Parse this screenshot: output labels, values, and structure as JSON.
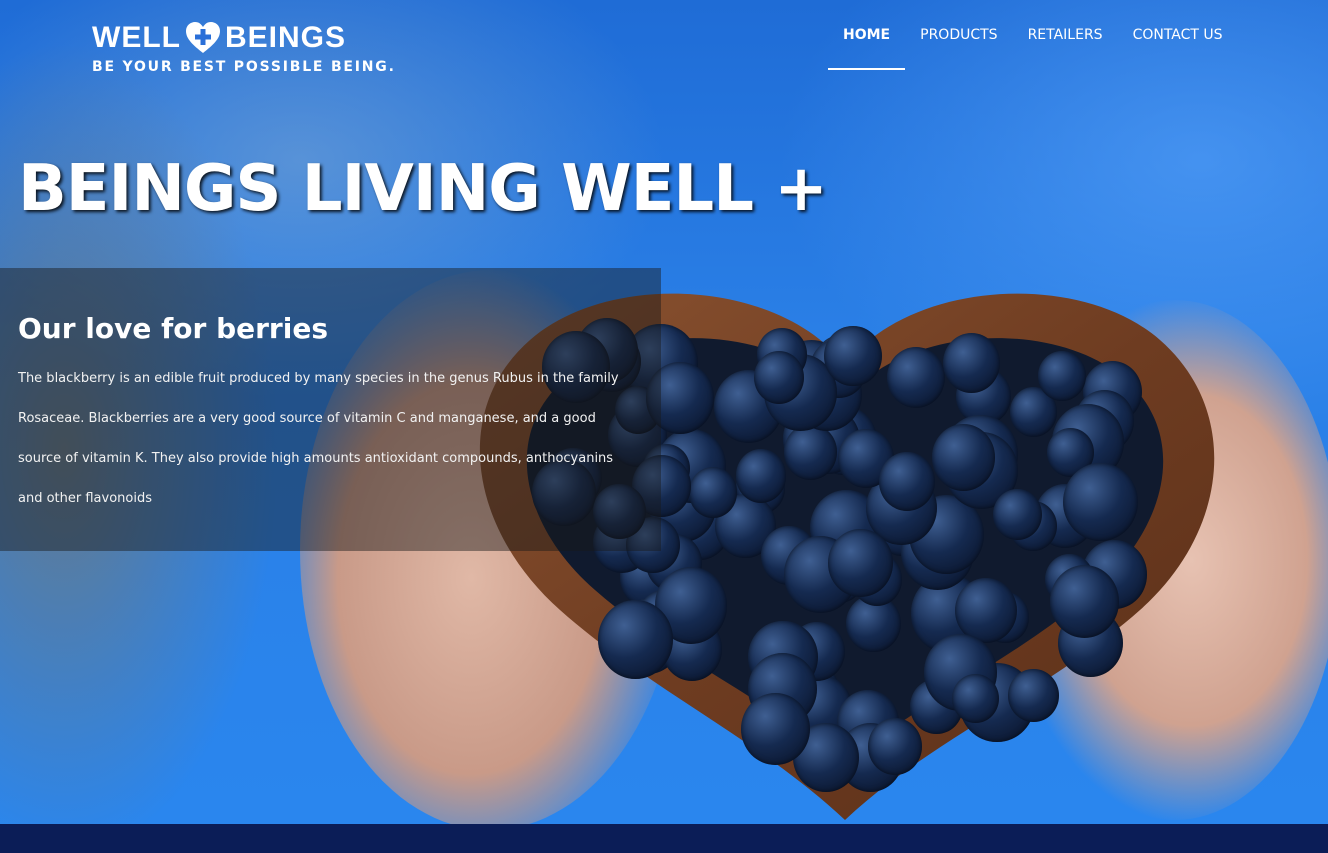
{
  "brand": {
    "name_left": "WELL",
    "name_right": "BEINGS",
    "tagline": "BE YOUR BEST POSSIBLE  BEING.",
    "logo_icon": "heart-plus-icon"
  },
  "nav": {
    "items": [
      {
        "label": "HOME",
        "active": true
      },
      {
        "label": "PRODUCTS",
        "active": false
      },
      {
        "label": "RETAILERS",
        "active": false
      },
      {
        "label": "CONTACT US",
        "active": false
      }
    ]
  },
  "hero": {
    "headline": "BEINGS LIVING WELL +",
    "image": "hands-holding-heart-bowl-of-blackberries"
  },
  "info": {
    "title": "Our love for berries",
    "text": "The blackberry is an edible fruit produced by many species in the genus Rubus in the family Rosaceae. Blackberries are a very good source of vitamin C and manganese, and a good source of vitamin K. They also provide high amounts antioxidant compounds, anthocyanins and other flavonoids"
  },
  "colors": {
    "footer": "#0b1d57",
    "hero_blue": "#2a7fe6"
  }
}
